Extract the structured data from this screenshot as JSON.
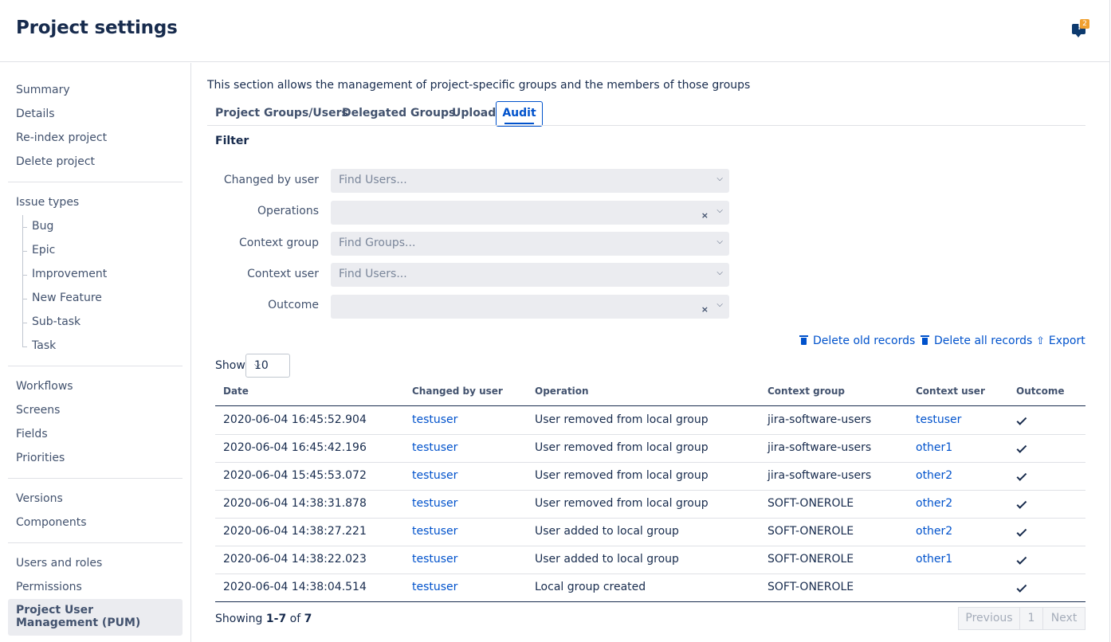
{
  "header": {
    "title": "Project settings",
    "notification_count": "2"
  },
  "sidebar": {
    "group1": [
      "Summary",
      "Details",
      "Re-index project",
      "Delete project"
    ],
    "issue_types_label": "Issue types",
    "issue_types": [
      "Bug",
      "Epic",
      "Improvement",
      "New Feature",
      "Sub-task",
      "Task"
    ],
    "group3": [
      "Workflows",
      "Screens",
      "Fields",
      "Priorities"
    ],
    "group4": [
      "Versions",
      "Components"
    ],
    "group5": [
      "Users and roles",
      "Permissions"
    ],
    "selected": "Project User Management (PUM)"
  },
  "main": {
    "intro": "This section allows the management of project-specific groups and the members of those groups",
    "tabs": [
      "Project Groups/Users",
      "Delegated Groups",
      "Upload",
      "Audit"
    ],
    "filter_title": "Filter",
    "filters": [
      {
        "label": "Changed by user",
        "placeholder": "Find Users..."
      },
      {
        "label": "Operations",
        "placeholder": ""
      },
      {
        "label": "Context group",
        "placeholder": "Find Groups..."
      },
      {
        "label": "Context user",
        "placeholder": "Find Users..."
      },
      {
        "label": "Outcome",
        "placeholder": ""
      }
    ],
    "actions": {
      "delete_old": "Delete old records",
      "delete_all": "Delete all records",
      "export": "Export"
    },
    "show_label": "Show",
    "show_value": "10",
    "columns": [
      "Date",
      "Changed by user",
      "Operation",
      "Context group",
      "Context user",
      "Outcome"
    ],
    "rows": [
      {
        "date": "2020-06-04 16:45:52.904",
        "user": "testuser",
        "operation": "User removed from local group",
        "group": "jira-software-users",
        "context_user": "testuser"
      },
      {
        "date": "2020-06-04 16:45:42.196",
        "user": "testuser",
        "operation": "User removed from local group",
        "group": "jira-software-users",
        "context_user": "other1"
      },
      {
        "date": "2020-06-04 15:45:53.072",
        "user": "testuser",
        "operation": "User removed from local group",
        "group": "jira-software-users",
        "context_user": "other2"
      },
      {
        "date": "2020-06-04 14:38:31.878",
        "user": "testuser",
        "operation": "User removed from local group",
        "group": "SOFT-ONEROLE",
        "context_user": "other2"
      },
      {
        "date": "2020-06-04 14:38:27.221",
        "user": "testuser",
        "operation": "User added to local group",
        "group": "SOFT-ONEROLE",
        "context_user": "other2"
      },
      {
        "date": "2020-06-04 14:38:22.023",
        "user": "testuser",
        "operation": "User added to local group",
        "group": "SOFT-ONEROLE",
        "context_user": "other1"
      },
      {
        "date": "2020-06-04 14:38:04.514",
        "user": "testuser",
        "operation": "Local group created",
        "group": "SOFT-ONEROLE",
        "context_user": ""
      }
    ],
    "showing": {
      "prefix": "Showing ",
      "range_start": "1",
      "dash": "-",
      "range_end": "7",
      "of": " of ",
      "total": "7"
    },
    "pager": {
      "previous": "Previous",
      "page": "1",
      "next": "Next"
    }
  }
}
